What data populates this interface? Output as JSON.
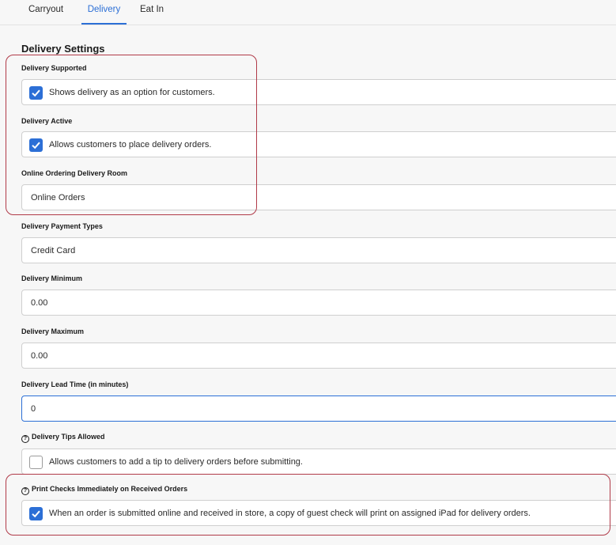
{
  "tabs": [
    {
      "label": "Carryout",
      "active": false
    },
    {
      "label": "Delivery",
      "active": true
    },
    {
      "label": "Eat In",
      "active": false
    }
  ],
  "section_title": "Delivery Settings",
  "fields": {
    "delivery_supported": {
      "label": "Delivery Supported",
      "checked": true,
      "text": "Shows delivery as an option for customers."
    },
    "delivery_active": {
      "label": "Delivery Active",
      "checked": true,
      "text": "Allows customers to place delivery orders."
    },
    "online_ordering_room": {
      "label": "Online Ordering Delivery Room",
      "value": "Online Orders"
    },
    "payment_types": {
      "label": "Delivery Payment Types",
      "value": "Credit Card"
    },
    "delivery_minimum": {
      "label": "Delivery Minimum",
      "value": "0.00"
    },
    "delivery_maximum": {
      "label": "Delivery Maximum",
      "value": "0.00"
    },
    "lead_time": {
      "label": "Delivery Lead Time (in minutes)",
      "value": "0"
    },
    "tips_allowed": {
      "label": "Delivery Tips Allowed",
      "checked": false,
      "text": "Allows customers to add a tip to delivery orders before submitting."
    },
    "print_checks": {
      "label": "Print Checks Immediately on Received Orders",
      "checked": true,
      "text": "When an order is submitted online and received in store, a copy of guest check will print on assigned iPad for delivery orders."
    }
  },
  "icons": {
    "help": "?"
  },
  "colors": {
    "accent": "#2c6fd6",
    "highlight": "#b03a48"
  }
}
